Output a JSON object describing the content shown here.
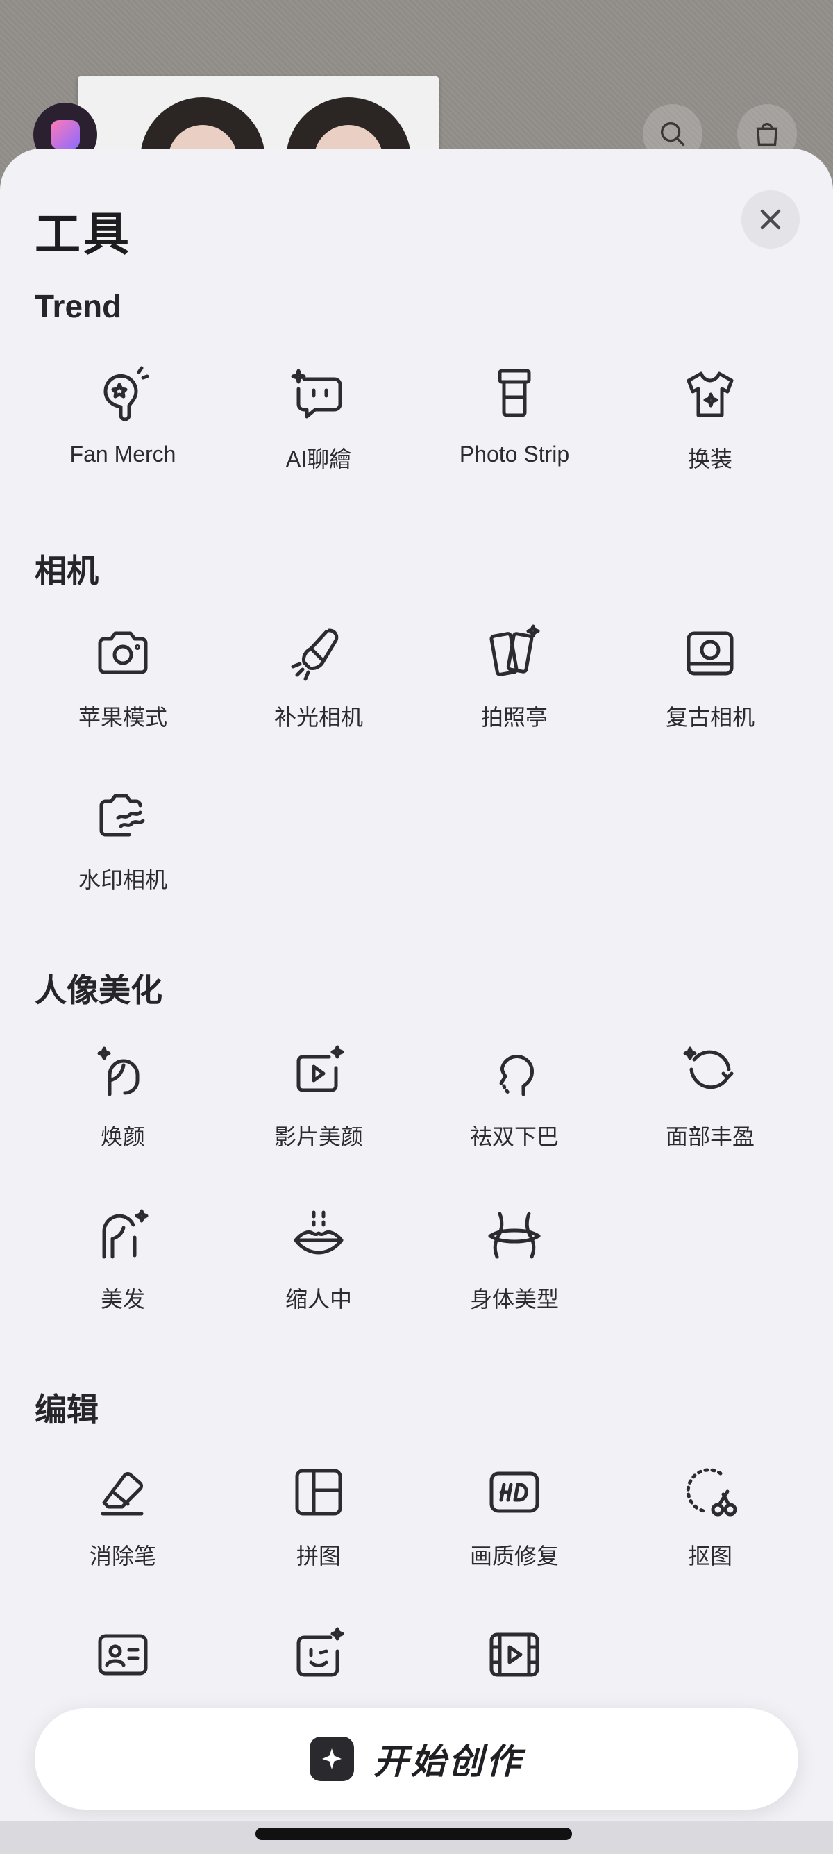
{
  "sheet": {
    "title": "工具",
    "close_label": "close"
  },
  "sections": [
    {
      "title": "Trend",
      "tools": [
        {
          "label": "Fan Merch",
          "icon": "fan-merch-icon"
        },
        {
          "label": "AI聊繪",
          "icon": "ai-chat-icon"
        },
        {
          "label": "Photo Strip",
          "icon": "photo-strip-icon"
        },
        {
          "label": "换装",
          "icon": "outfit-icon"
        }
      ]
    },
    {
      "title": "相机",
      "tools": [
        {
          "label": "苹果模式",
          "icon": "camera-icon"
        },
        {
          "label": "补光相机",
          "icon": "fill-light-icon"
        },
        {
          "label": "拍照亭",
          "icon": "photo-booth-icon"
        },
        {
          "label": "复古相机",
          "icon": "retro-camera-icon"
        },
        {
          "label": "水印相机",
          "icon": "watermark-camera-icon"
        }
      ]
    },
    {
      "title": "人像美化",
      "tools": [
        {
          "label": "焕颜",
          "icon": "face-glow-icon"
        },
        {
          "label": "影片美颜",
          "icon": "video-beauty-icon"
        },
        {
          "label": "祛双下巴",
          "icon": "double-chin-icon"
        },
        {
          "label": "面部丰盈",
          "icon": "face-plump-icon"
        },
        {
          "label": "美发",
          "icon": "hair-icon"
        },
        {
          "label": "缩人中",
          "icon": "lips-icon"
        },
        {
          "label": "身体美型",
          "icon": "body-shape-icon"
        }
      ]
    },
    {
      "title": "编辑",
      "tools": [
        {
          "label": "消除笔",
          "icon": "eraser-icon"
        },
        {
          "label": "拼图",
          "icon": "collage-icon"
        },
        {
          "label": "画质修复",
          "icon": "hd-icon"
        },
        {
          "label": "抠图",
          "icon": "cutout-icon"
        },
        {
          "label": "",
          "icon": "id-card-icon"
        },
        {
          "label": "",
          "icon": "sticker-face-icon"
        },
        {
          "label": "",
          "icon": "video-edit-icon"
        }
      ]
    }
  ],
  "cta": {
    "label": "开始创作",
    "icon": "sparkle-icon"
  },
  "background": {
    "search_icon": "search-icon",
    "bag_icon": "shopping-bag-icon"
  }
}
